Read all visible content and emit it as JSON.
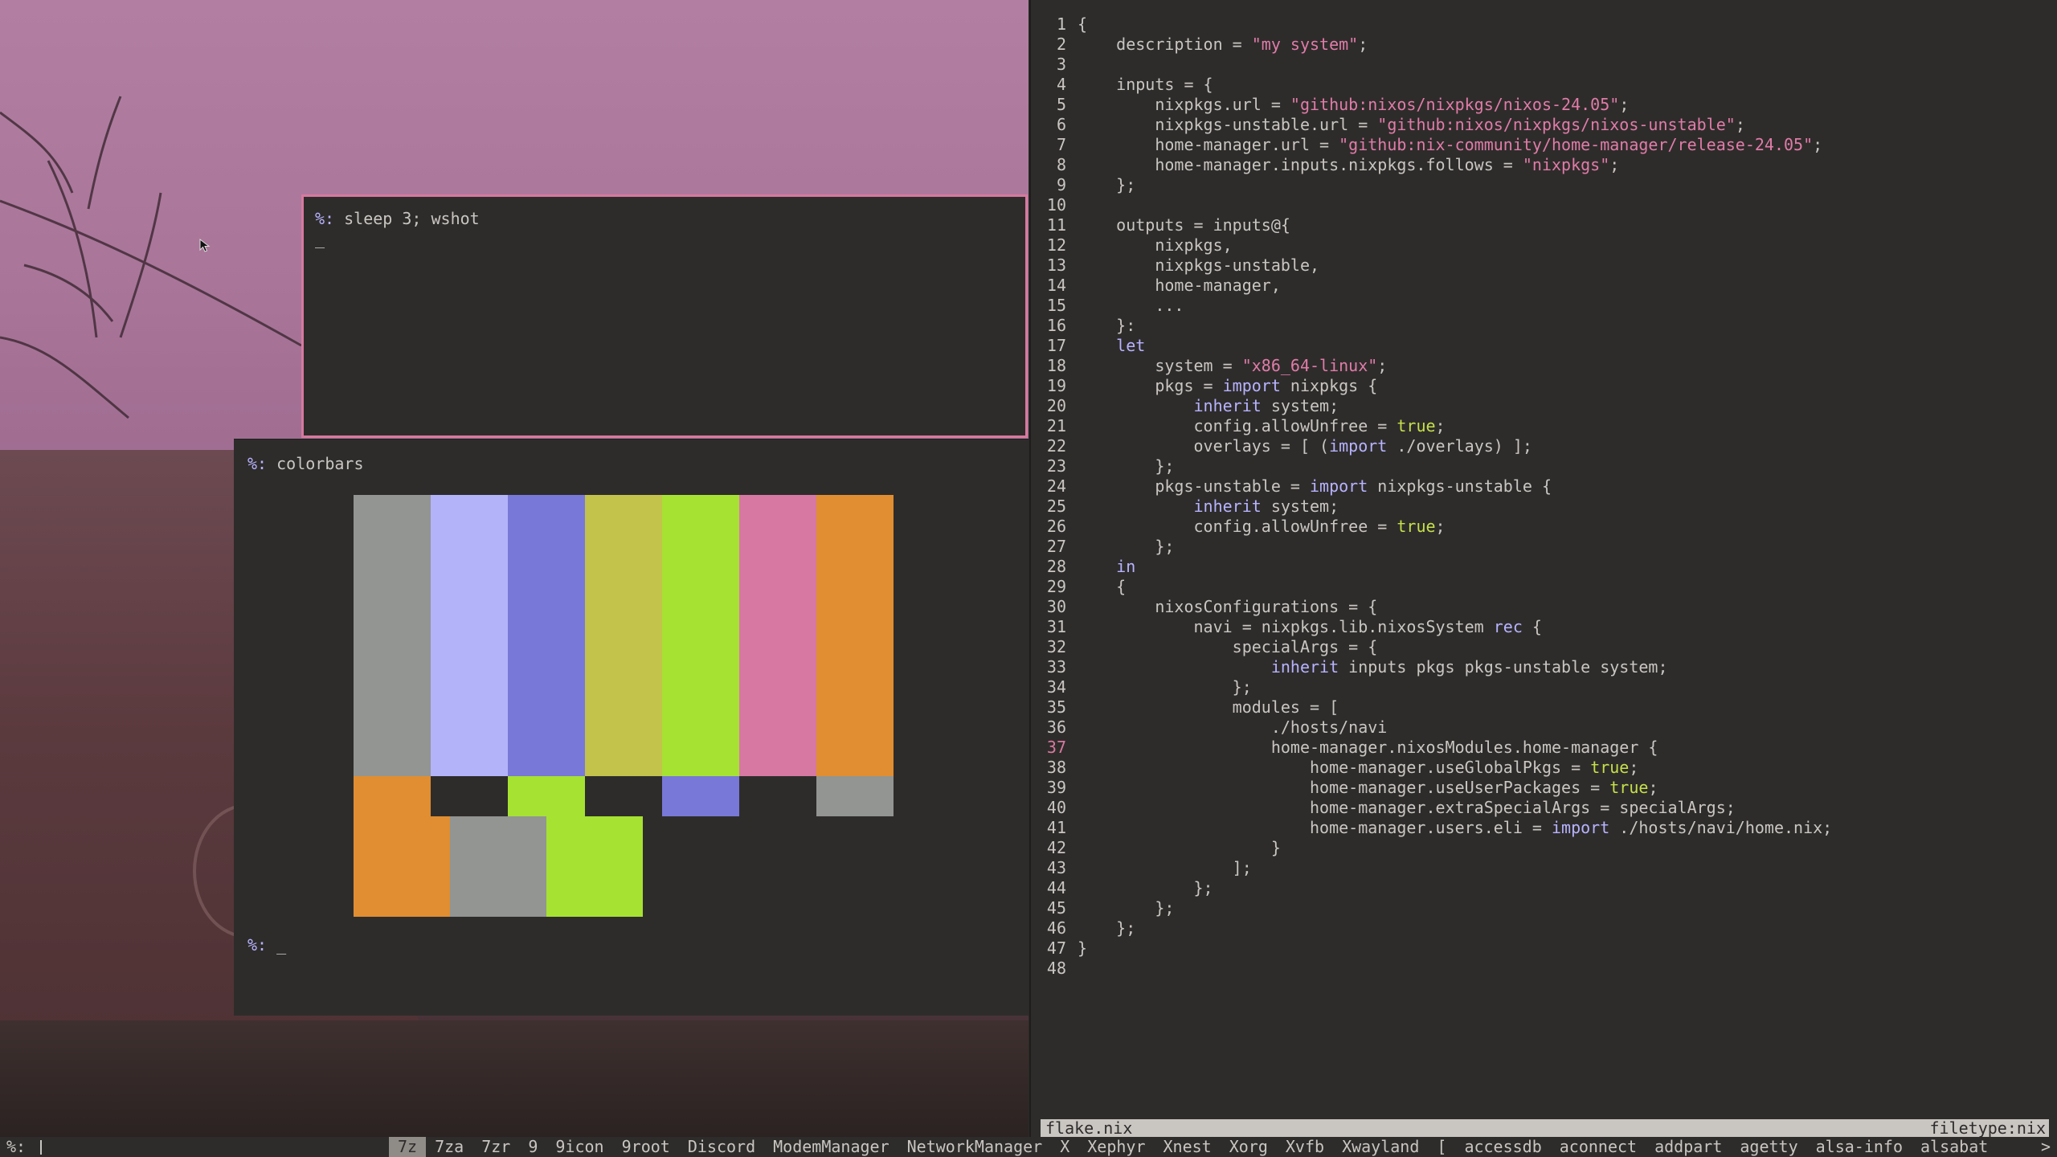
{
  "terminals": {
    "sleep": {
      "prompt": "%:",
      "command": "sleep 3; wshot",
      "cursor": "_"
    },
    "colorbars": {
      "prompt": "%:",
      "command": "colorbars",
      "next_prompt": "%:",
      "cursor": "_",
      "top_bars": [
        "#929592",
        "#b3b3fa",
        "#7878d8",
        "#c3c24b",
        "#a6e232",
        "#d778a3",
        "#e08e31"
      ],
      "mid_bars": [
        "#e08e31",
        "#2e2c2b",
        "#a6e232",
        "#2e2c2b",
        "#7878d8",
        "#2e2c2b",
        "#929592"
      ],
      "bottom_bars": [
        "#e08e31",
        "#929592",
        "#a6e232"
      ]
    }
  },
  "editor": {
    "filename": "flake.nix",
    "filetype": "filetype:nix",
    "current_line": 37,
    "lines": [
      [
        [
          "",
          "{"
        ]
      ],
      [
        [
          "",
          "    description = "
        ],
        [
          "st",
          "\"my system\""
        ],
        [
          "",
          ";"
        ]
      ],
      [
        [
          "",
          ""
        ]
      ],
      [
        [
          "",
          "    inputs = {"
        ]
      ],
      [
        [
          "",
          "        nixpkgs.url = "
        ],
        [
          "st",
          "\"github:nixos/nixpkgs/nixos-24.05\""
        ],
        [
          "",
          ";"
        ]
      ],
      [
        [
          "",
          "        nixpkgs-unstable.url = "
        ],
        [
          "st",
          "\"github:nixos/nixpkgs/nixos-unstable\""
        ],
        [
          "",
          ";"
        ]
      ],
      [
        [
          "",
          "        home-manager.url = "
        ],
        [
          "st",
          "\"github:nix-community/home-manager/release-24.05\""
        ],
        [
          "",
          ";"
        ]
      ],
      [
        [
          "",
          "        home-manager.inputs.nixpkgs.follows = "
        ],
        [
          "st",
          "\"nixpkgs\""
        ],
        [
          "",
          ";"
        ]
      ],
      [
        [
          "",
          "    };"
        ]
      ],
      [
        [
          "",
          ""
        ]
      ],
      [
        [
          "",
          "    outputs = inputs@{"
        ]
      ],
      [
        [
          "",
          "        nixpkgs,"
        ]
      ],
      [
        [
          "",
          "        nixpkgs-unstable,"
        ]
      ],
      [
        [
          "",
          "        home-manager,"
        ]
      ],
      [
        [
          "",
          "        ..."
        ]
      ],
      [
        [
          "",
          "    }:"
        ]
      ],
      [
        [
          "kw",
          "    let"
        ]
      ],
      [
        [
          "",
          "        system = "
        ],
        [
          "st",
          "\"x86_64-linux\""
        ],
        [
          "",
          ";"
        ]
      ],
      [
        [
          "",
          "        pkgs = "
        ],
        [
          "kw",
          "import"
        ],
        [
          "",
          " nixpkgs {"
        ]
      ],
      [
        [
          "kw",
          "            inherit"
        ],
        [
          "",
          " system;"
        ]
      ],
      [
        [
          "",
          "            config.allowUnfree = "
        ],
        [
          "bo",
          "true"
        ],
        [
          "",
          ";"
        ]
      ],
      [
        [
          "",
          "            overlays = [ ("
        ],
        [
          "kw",
          "import"
        ],
        [
          "",
          " ./overlays) ];"
        ]
      ],
      [
        [
          "",
          "        };"
        ]
      ],
      [
        [
          "",
          "        pkgs-unstable = "
        ],
        [
          "kw",
          "import"
        ],
        [
          "",
          " nixpkgs-unstable {"
        ]
      ],
      [
        [
          "kw",
          "            inherit"
        ],
        [
          "",
          " system;"
        ]
      ],
      [
        [
          "",
          "            config.allowUnfree = "
        ],
        [
          "bo",
          "true"
        ],
        [
          "",
          ";"
        ]
      ],
      [
        [
          "",
          "        };"
        ]
      ],
      [
        [
          "kw",
          "    in"
        ]
      ],
      [
        [
          "",
          "    {"
        ]
      ],
      [
        [
          "",
          "        nixosConfigurations = {"
        ]
      ],
      [
        [
          "",
          "            navi = nixpkgs.lib.nixosSystem "
        ],
        [
          "kw",
          "rec"
        ],
        [
          "",
          " {"
        ]
      ],
      [
        [
          "",
          "                specialArgs = {"
        ]
      ],
      [
        [
          "kw",
          "                    inherit"
        ],
        [
          "",
          " inputs pkgs pkgs-unstable system;"
        ]
      ],
      [
        [
          "",
          "                };"
        ]
      ],
      [
        [
          "",
          "                modules = ["
        ]
      ],
      [
        [
          "",
          "                    ./hosts/navi"
        ]
      ],
      [
        [
          "",
          "                    home-manager.nixosModules.home-manager {"
        ]
      ],
      [
        [
          "",
          "                        home-manager.useGlobalPkgs = "
        ],
        [
          "bo",
          "true"
        ],
        [
          "",
          ";"
        ]
      ],
      [
        [
          "",
          "                        home-manager.useUserPackages = "
        ],
        [
          "bo",
          "true"
        ],
        [
          "",
          ";"
        ]
      ],
      [
        [
          "",
          "                        home-manager.extraSpecialArgs = specialArgs;"
        ]
      ],
      [
        [
          "",
          "                        home-manager.users.eli = "
        ],
        [
          "kw",
          "import"
        ],
        [
          "",
          " ./hosts/navi/home.nix;"
        ]
      ],
      [
        [
          "",
          "                    }"
        ]
      ],
      [
        [
          "",
          "                ];"
        ]
      ],
      [
        [
          "",
          "            };"
        ]
      ],
      [
        [
          "",
          "        };"
        ]
      ],
      [
        [
          "",
          "    };"
        ]
      ],
      [
        [
          "",
          "}"
        ]
      ],
      [
        [
          "",
          ""
        ]
      ]
    ]
  },
  "bottombar": {
    "prompt": "%:",
    "more": ">",
    "tasks": [
      "7z",
      "7za",
      "7zr",
      "9",
      "9icon",
      "9root",
      "Discord",
      "ModemManager",
      "NetworkManager",
      "X",
      "Xephyr",
      "Xnest",
      "Xorg",
      "Xvfb",
      "Xwayland",
      "[",
      "accessdb",
      "aconnect",
      "addpart",
      "agetty",
      "alsa-info",
      "alsabat"
    ],
    "active_task": "7z"
  },
  "icons": {
    "pointer": "mouse-pointer-icon"
  },
  "colors": {
    "accent_pink": "#d7799f",
    "prompt_purple": "#b7b3ff",
    "string_pink": "#e07ca8",
    "bool_green": "#c5e04a",
    "background": "#2e2c2b"
  }
}
